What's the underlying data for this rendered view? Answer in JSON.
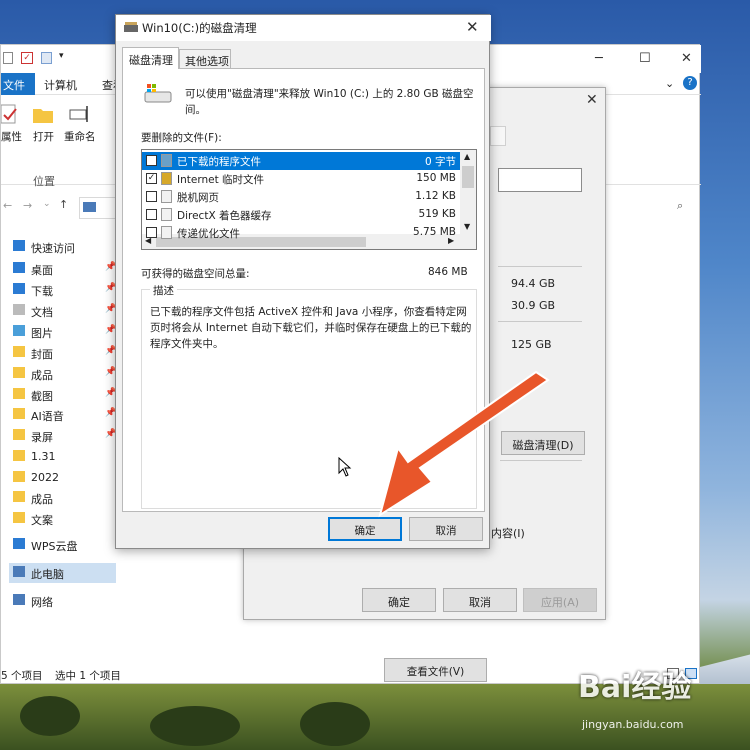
{
  "dialog": {
    "title": "Win10(C:)的磁盘清理",
    "tabs": [
      {
        "label": "磁盘清理"
      },
      {
        "label": "其他选项"
      }
    ],
    "intro": "可以使用\"磁盘清理\"来释放 Win10 (C:) 上的 2.80 GB 磁盘空间。",
    "files_label": "要删除的文件(F):",
    "files": [
      {
        "name": "已下载的程序文件",
        "size": "0 字节",
        "checked": true,
        "selected": true
      },
      {
        "name": "Internet 临时文件",
        "size": "150 MB",
        "checked": true,
        "selected": false
      },
      {
        "name": "脱机网页",
        "size": "1.12 KB",
        "checked": false,
        "selected": false
      },
      {
        "name": "DirectX 着色器缓存",
        "size": "519 KB",
        "checked": false,
        "selected": false
      },
      {
        "name": "传递优化文件",
        "size": "5.75 MB",
        "checked": false,
        "selected": false
      }
    ],
    "total_label": "可获得的磁盘空间总量:",
    "total_value": "846 MB",
    "desc_legend": "描述",
    "desc_text": "已下载的程序文件包括 ActiveX 控件和 Java 小程序，你查看特定网页时将会从 Internet 自动下载它们，并临时保存在硬盘上的已下载的程序文件夹中。",
    "view_files": "查看文件(V)",
    "ok": "确定",
    "cancel": "取消"
  },
  "props": {
    "values": [
      "94.4 GB",
      "30.9 GB",
      "125 GB"
    ],
    "disk_cleanup": "磁盘清理(D)",
    "content_label": "内容(I)",
    "ok": "确定",
    "cancel": "取消",
    "apply": "应用(A)"
  },
  "explorer": {
    "ribbon_tabs": {
      "file": "文件",
      "computer": "计算机",
      "view": "查看"
    },
    "ribbon_buttons": [
      "属性",
      "打开",
      "重命名"
    ],
    "ribbon_group": "位置",
    "nav": [
      {
        "label": "快速访问",
        "icon": "star-icon",
        "pin": false
      },
      {
        "label": "桌面",
        "icon": "desktop-icon",
        "pin": true
      },
      {
        "label": "下载",
        "icon": "download-icon",
        "pin": true
      },
      {
        "label": "文档",
        "icon": "document-icon",
        "pin": true
      },
      {
        "label": "图片",
        "icon": "picture-icon",
        "pin": true
      },
      {
        "label": "封面",
        "icon": "folder-icon",
        "pin": true
      },
      {
        "label": "成品",
        "icon": "folder-icon",
        "pin": true
      },
      {
        "label": "截图",
        "icon": "folder-icon",
        "pin": true
      },
      {
        "label": "AI语音",
        "icon": "folder-icon",
        "pin": true
      },
      {
        "label": "录屏",
        "icon": "folder-icon",
        "pin": true
      },
      {
        "label": "1.31",
        "icon": "folder-icon",
        "pin": false
      },
      {
        "label": "2022",
        "icon": "folder-icon",
        "pin": false
      },
      {
        "label": "成品",
        "icon": "folder-icon",
        "pin": false
      },
      {
        "label": "文案",
        "icon": "folder-icon",
        "pin": false
      },
      {
        "label": "WPS云盘",
        "icon": "cloud-icon",
        "pin": false
      },
      {
        "label": "此电脑",
        "icon": "pc-icon",
        "pin": false
      },
      {
        "label": "网络",
        "icon": "network-icon",
        "pin": false
      }
    ],
    "status_items": "5 个项目",
    "status_selected": "选中 1 个项目"
  },
  "watermark": {
    "brand": "Bai经验",
    "url": "jingyan.baidu.com"
  },
  "colors": {
    "accent": "#0078d7",
    "arrow": "#e8562a",
    "file_tab": "#1a73c7"
  }
}
